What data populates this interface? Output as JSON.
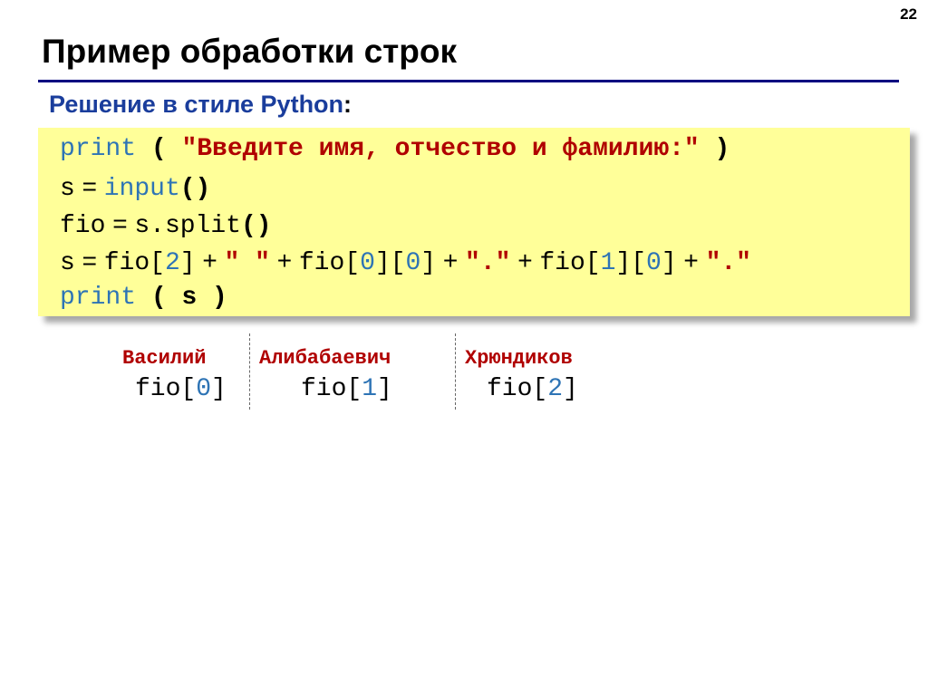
{
  "slide": {
    "page_number": "22",
    "title": "Пример обработки строк",
    "subtitle": "Решение в стиле Python",
    "subtitle_colon": ":"
  },
  "code": {
    "line1": {
      "kw": "print",
      "open": " ( ",
      "str": "\"Введите имя, отчество и фамилию:\"",
      "close": " )"
    },
    "line2": {
      "var": "s",
      "eq": " = ",
      "call": "input",
      "parens": "()"
    },
    "line3": {
      "var": "fio",
      "eq": " = ",
      "call": "s.split",
      "parens": "()"
    },
    "line4": {
      "s": "s",
      "eq": " = ",
      "a": "fio[",
      "i2": "2",
      "b": "]",
      "plus1": " + ",
      "sp": "\" \"",
      "plus2": " + ",
      "c": "fio[",
      "i0a": "0",
      "d": "][",
      "i0b": "0",
      "e": "]",
      "plus3": " + ",
      "dot1": "\".\"",
      "plus4": " + ",
      "f": "fio[",
      "i1": "1",
      "g": "][",
      "i0c": "0",
      "h": "]",
      "plus5": " + ",
      "dot2": "\".\""
    },
    "line5": {
      "kw": "print",
      "open": " ( ",
      "arg": "s",
      "close": " )"
    }
  },
  "name_parts": [
    {
      "text": "Василий",
      "label_prefix": "fio[",
      "index": "0",
      "label_suffix": "]"
    },
    {
      "text": "Алибабаевич",
      "label_prefix": "fio[",
      "index": "1",
      "label_suffix": "]"
    },
    {
      "text": "Хрюндиков",
      "label_prefix": "fio[",
      "index": "2",
      "label_suffix": "]"
    }
  ],
  "colors": {
    "title_underline": "#000080",
    "subtitle": "#1a3d9c",
    "code_background": "#ffff99",
    "keyword": "#2e74b5",
    "string": "#b00000"
  }
}
